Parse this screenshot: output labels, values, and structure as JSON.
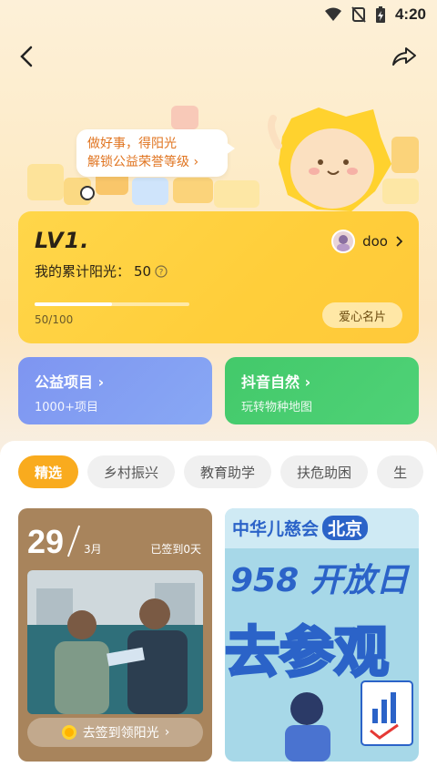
{
  "status": {
    "time": "4:20"
  },
  "hero": {
    "bubble_line1": "做好事，得阳光",
    "bubble_line2": "解锁公益荣誉等级"
  },
  "level_card": {
    "level": "LV1.",
    "username": "doo",
    "sun_label": "我的累计阳光：",
    "sun_value": "50",
    "progress_text": "50/100",
    "progress_fraction": 0.5,
    "button": "爱心名片"
  },
  "features": [
    {
      "title": "公益项目",
      "sub": "1000+项目"
    },
    {
      "title": "抖音自然",
      "sub": "玩转物种地图"
    }
  ],
  "tabs": [
    "精选",
    "乡村振兴",
    "教育助学",
    "扶危助困",
    "生"
  ],
  "post": {
    "day": "29",
    "month": "3月",
    "signed": "已签到0天",
    "checkin": "去签到领阳光"
  },
  "poster": {
    "org": "中华儿慈会",
    "city": "北京",
    "line1": "958 开放日",
    "line2": "去参观"
  },
  "colors": {
    "accent": "#f9ab1e",
    "level_card": "#ffd64a",
    "feature_left": "#7e95f1",
    "feature_right": "#43c96a"
  }
}
